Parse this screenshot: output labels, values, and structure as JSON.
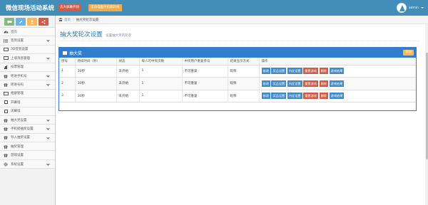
{
  "header": {
    "brand": "微信现场活动系统",
    "btn_red": "去大屏幕开始",
    "btn_orange": "活动电脑手机端开始",
    "username": "admin"
  },
  "sidebar": {
    "shortcuts": [
      "chat-icon",
      "pencil-icon",
      "users-icon",
      "share-icon"
    ],
    "items": [
      {
        "icon": "dashboard-icon",
        "label": "首页",
        "arrow": false
      },
      {
        "icon": "list-icon",
        "label": "签到设置",
        "arrow": true
      },
      {
        "icon": "desktop-icon",
        "label": "3D签到设置",
        "arrow": false
      },
      {
        "icon": "desktop-icon",
        "label": "上墙消息管理",
        "arrow": true
      },
      {
        "icon": "bar-chart-icon",
        "label": "投票管理",
        "arrow": false
      },
      {
        "icon": "gift-icon",
        "label": "摇进手机号",
        "arrow": true
      },
      {
        "icon": "gift-icon",
        "label": "摇进号码",
        "arrow": true
      },
      {
        "icon": "desktop-icon",
        "label": "相册管理",
        "arrow": false
      },
      {
        "icon": "square-icon",
        "label": "开幕墙",
        "arrow": false
      },
      {
        "icon": "square-icon",
        "label": "闭幕墙",
        "arrow": false
      },
      {
        "icon": "gift-icon",
        "label": "抽大奖设置",
        "arrow": true
      },
      {
        "icon": "gift-icon",
        "label": "手机摇抽奖设置",
        "arrow": true
      },
      {
        "icon": "gift-icon",
        "label": "导入抽奖设置",
        "arrow": true
      },
      {
        "icon": "gift-icon",
        "label": "抽奖管理",
        "arrow": false
      },
      {
        "icon": "gift-icon",
        "label": "游戏设置",
        "arrow": false
      },
      {
        "icon": "gear-icon",
        "label": "系统设置",
        "arrow": true
      }
    ]
  },
  "breadcrumb": {
    "home": "首页",
    "current": "抽大奖轮次设置"
  },
  "page": {
    "title": "抽大奖轮次设置",
    "subtitle": "设置抽大奖的轮次"
  },
  "widget": {
    "title": "抽大奖",
    "add_label": "添加"
  },
  "table": {
    "headers": [
      "序号",
      "持续时间（秒）",
      "状态",
      "每人可中奖次数",
      "中奖用户重复参与",
      "结果显示方式",
      "操作"
    ],
    "rows": [
      {
        "no": "1",
        "duration": "30秒",
        "status": "未开始",
        "times": "1",
        "repeat": "不可重复",
        "display": "昵称"
      },
      {
        "no": "2",
        "duration": "30秒",
        "status": "未开始",
        "times": "1",
        "repeat": "不可重复",
        "display": "昵称"
      },
      {
        "no": "3",
        "duration": "30秒",
        "status": "未开始",
        "times": "1",
        "repeat": "不可重复",
        "display": "昵称"
      }
    ],
    "actions": [
      {
        "label": "修改",
        "color": "blue"
      },
      {
        "label": "奖品设置",
        "color": "blue"
      },
      {
        "label": "内定设置",
        "color": "blue"
      },
      {
        "label": "重置游戏",
        "color": "red"
      },
      {
        "label": "删除",
        "color": "red"
      },
      {
        "label": "游戏结果",
        "color": "blue"
      }
    ]
  },
  "colors": {
    "header_bg": "#438eb9",
    "widget_header": "#307ecc",
    "title_blue": "#2679b5",
    "btn_blue": "#428bca",
    "btn_red": "#d15b47",
    "btn_orange": "#ffb752"
  }
}
